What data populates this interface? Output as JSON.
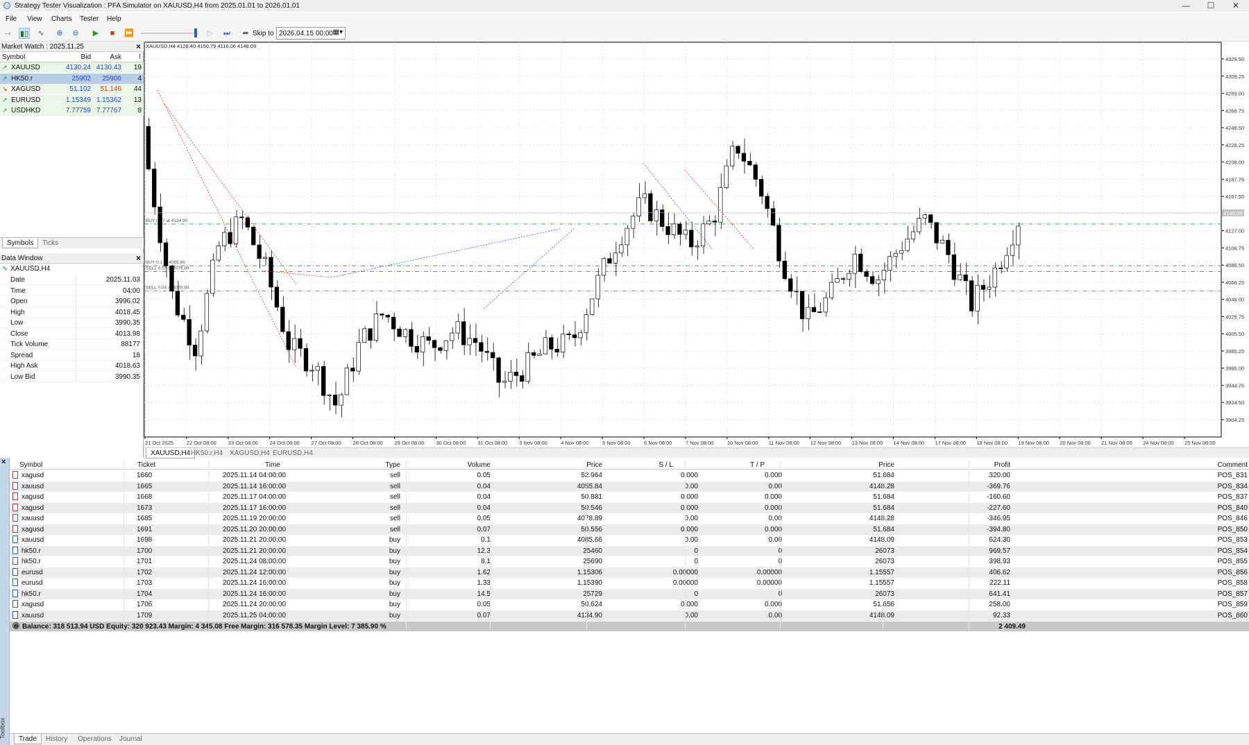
{
  "window": {
    "title": "Strategy Tester Visualization : PFA Simulator on XAUUSD,H4 from 2025.01.01 to 2026.01.01"
  },
  "menu": [
    "File",
    "View",
    "Charts",
    "Tester",
    "Help"
  ],
  "toolbar": {
    "skip_label": "Skip to",
    "skip_value": "2026.04.15 00:00"
  },
  "market_watch": {
    "title": "Market Watch : 2025.11.25",
    "headers": {
      "symbol": "Symbol",
      "bid": "Bid",
      "ask": "Ask",
      "spread": "!"
    },
    "rows": [
      {
        "symbol": "XAUUSD",
        "bid": "4130.24",
        "ask": "4130.43",
        "spread": "19",
        "dir": "up"
      },
      {
        "symbol": "HK50.r",
        "bid": "25902",
        "ask": "25906",
        "spread": "4",
        "dir": "up"
      },
      {
        "symbol": "XAGUSD",
        "bid": "51.102",
        "ask": "51.146",
        "spread": "44",
        "dir": "down"
      },
      {
        "symbol": "EURUSD",
        "bid": "1.15349",
        "ask": "1.15362",
        "spread": "13",
        "dir": "up"
      },
      {
        "symbol": "USDHKD",
        "bid": "7.77759",
        "ask": "7.77767",
        "spread": "8",
        "dir": "up"
      }
    ],
    "tabs": [
      "Symbols",
      "Ticks"
    ]
  },
  "data_window": {
    "title": "Data Window",
    "symbol": "XAUUSD,H4",
    "rows": [
      {
        "k": "Date",
        "v": "2025.11.03"
      },
      {
        "k": "Time",
        "v": "04:00"
      },
      {
        "k": "Open",
        "v": "3996.02"
      },
      {
        "k": "High",
        "v": "4018.45"
      },
      {
        "k": "Low",
        "v": "3990.35"
      },
      {
        "k": "Close",
        "v": "4013.98"
      },
      {
        "k": "Tick Volume",
        "v": "88177"
      },
      {
        "k": "Spread",
        "v": "18"
      },
      {
        "k": "High Ask",
        "v": "4018.63"
      },
      {
        "k": "Low Bid",
        "v": "3990.35"
      }
    ]
  },
  "chart": {
    "header": "XAUUSD,H4  4128.40 4150.79 4116.06 4148.09",
    "price_labels": [
      "4329.50",
      "4309.25",
      "4289.00",
      "4268.75",
      "4248.50",
      "4228.25",
      "4208.00",
      "4187.75",
      "4167.50",
      "4147.25",
      "4127.00",
      "4106.75",
      "4086.50",
      "4066.25",
      "4046.00",
      "4025.75",
      "4005.50",
      "3985.25",
      "3965.00",
      "3944.75",
      "3924.50",
      "3904.25"
    ],
    "current_price": "4148.09",
    "time_labels": [
      "21 Oct 2025",
      "22 Oct 08:00",
      "23 Oct 08:00",
      "24 Oct 08:00",
      "27 Oct 08:00",
      "28 Oct 08:00",
      "29 Oct 08:00",
      "30 Oct 08:00",
      "31 Oct 08:00",
      "3 Nov 08:00",
      "4 Nov 08:00",
      "5 Nov 08:00",
      "6 Nov 08:00",
      "7 Nov 08:00",
      "10 Nov 08:00",
      "11 Nov 08:00",
      "12 Nov 08:00",
      "13 Nov 08:00",
      "14 Nov 08:00",
      "17 Nov 08:00",
      "18 Nov 08:00",
      "19 Nov 08:00",
      "20 Nov 08:00",
      "21 Nov 08:00",
      "24 Nov 08:00",
      "25 Nov 08:00"
    ],
    "level_labels": [
      "BUY 0.07 at 4134.90",
      "BUY 0.1 at 4085.66",
      "SELL 0.05 at 4078.89",
      "SELL 0.04 at 4055.84"
    ],
    "tabs": [
      "XAUUSD,H4",
      "HK50.r,H4",
      "XAGUSD,H4",
      "EURUSD,H4"
    ],
    "colors": {
      "buy_arrow": "#2a5ec2",
      "sell_arrow": "#d8321e",
      "level": "#2e9a3a",
      "up_candle": "#ffffff",
      "down_candle": "#000000"
    }
  },
  "trade": {
    "headers": [
      "Symbol",
      "Ticket",
      "Time",
      "Type",
      "Volume",
      "Price",
      "S / L",
      "T / P",
      "Price",
      "Profit",
      "Comment"
    ],
    "rows": [
      [
        "xagusd",
        "1660",
        "2025.11.14 04:00:00",
        "sell",
        "0.05",
        "52.964",
        "0.000",
        "0.000",
        "51.684",
        "320.00",
        "POS_831"
      ],
      [
        "xauusd",
        "1665",
        "2025.11.14 16:00:00",
        "sell",
        "0.04",
        "4055.84",
        "0.00",
        "0.00",
        "4148.28",
        "-369.76",
        "POS_834"
      ],
      [
        "xagusd",
        "1668",
        "2025.11.17 04:00:00",
        "sell",
        "0.04",
        "50.881",
        "0.000",
        "0.000",
        "51.684",
        "-160.60",
        "POS_837"
      ],
      [
        "xagusd",
        "1673",
        "2025.11.17 16:00:00",
        "sell",
        "0.04",
        "50.546",
        "0.000",
        "0.000",
        "51.684",
        "-227.60",
        "POS_840"
      ],
      [
        "xauusd",
        "1685",
        "2025.11.19 20:00:00",
        "sell",
        "0.05",
        "4078.89",
        "0.00",
        "0.00",
        "4148.28",
        "-346.95",
        "POS_846"
      ],
      [
        "xagusd",
        "1691",
        "2025.11.20 20:00:00",
        "sell",
        "0.07",
        "50.556",
        "0.000",
        "0.000",
        "51.684",
        "-394.80",
        "POS_850"
      ],
      [
        "xauusd",
        "1698",
        "2025.11.21 20:00:00",
        "buy",
        "0.1",
        "4085.66",
        "0.00",
        "0.00",
        "4148.09",
        "624.30",
        "POS_853"
      ],
      [
        "hk50.r",
        "1700",
        "2025.11.21 20:00:00",
        "buy",
        "12.3",
        "25460",
        "0",
        "0",
        "26073",
        "969.57",
        "POS_854"
      ],
      [
        "hk50.r",
        "1701",
        "2025.11.24 08:00:00",
        "buy",
        "8.1",
        "25690",
        "0",
        "0",
        "26073",
        "398.93",
        "POS_855"
      ],
      [
        "eurusd",
        "1702",
        "2025.11.24 12:00:00",
        "buy",
        "1.62",
        "1.15306",
        "0.00000",
        "0.00000",
        "1.15557",
        "406.62",
        "POS_856"
      ],
      [
        "eurusd",
        "1703",
        "2025.11.24 16:00:00",
        "buy",
        "1.33",
        "1.15390",
        "0.00000",
        "0.00000",
        "1.15557",
        "222.11",
        "POS_858"
      ],
      [
        "hk50.r",
        "1704",
        "2025.11.24 16:00:00",
        "buy",
        "14.5",
        "25729",
        "0",
        "0",
        "26073",
        "641.41",
        "POS_857"
      ],
      [
        "xagusd",
        "1706",
        "2025.11.24 20:00:00",
        "buy",
        "0.05",
        "50.624",
        "0.000",
        "0.000",
        "51.656",
        "258.00",
        "POS_859"
      ],
      [
        "xauusd",
        "1709",
        "2025.11.25 04:00:00",
        "buy",
        "0.07",
        "4134.90",
        "0.00",
        "0.00",
        "4148.09",
        "92.33",
        "POS_860"
      ]
    ],
    "balance_line": "Balance: 318 513.94 USD   Equity: 320 923.43   Margin: 4 345.08   Free Margin: 316 578.35   Margin Level: 7 385.90 %",
    "total_profit": "2 409.49"
  },
  "bottom_tabs": [
    "Trade",
    "History",
    "Operations",
    "Journal"
  ],
  "toolbox_label": "Toolbox"
}
